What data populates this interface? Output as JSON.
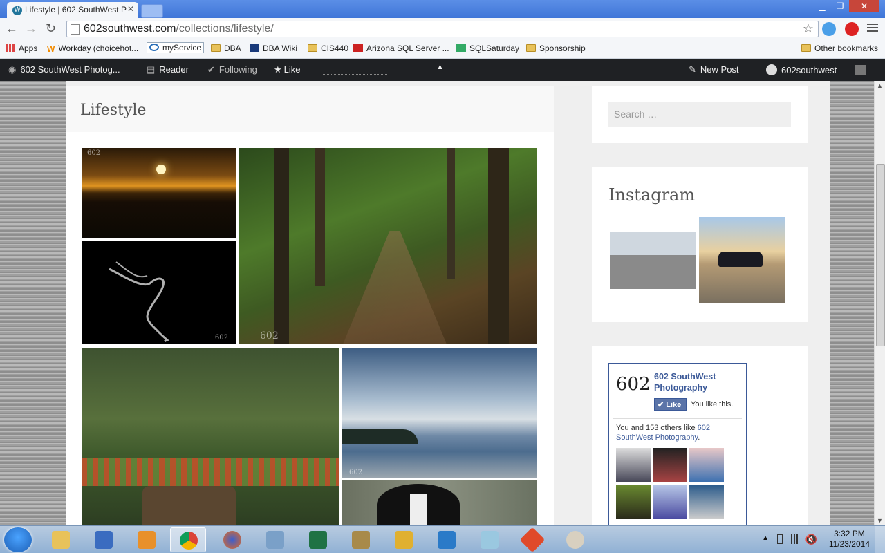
{
  "browser": {
    "tab_title": "Lifestyle | 602 SouthWest P",
    "url_host": "602southwest.com",
    "url_path": "/collections/lifestyle/",
    "bookmarks": [
      "Apps",
      "Workday (choicehot...",
      "myService",
      "DBA",
      "DBA Wiki",
      "CIS440",
      "Arizona SQL Server ...",
      "SQLSaturday",
      "Sponsorship"
    ],
    "other_bookmarks": "Other bookmarks"
  },
  "wpbar": {
    "site": "602 SouthWest Photog...",
    "reader": "Reader",
    "following": "Following",
    "like": "Like",
    "new_post": "New Post",
    "user": "602southwest"
  },
  "main": {
    "title": "Lifestyle",
    "watermark": "602"
  },
  "sidebar": {
    "search_placeholder": "Search …",
    "instagram_title": "Instagram",
    "facebook": {
      "logo": "602",
      "page_name": "602 SouthWest Photography",
      "like_label": "Like",
      "you_like": "You like this.",
      "others_prefix": "You and 153 others like",
      "others_link": "602 SouthWest Photography",
      "others_suffix": "."
    }
  },
  "taskbar": {
    "time": "3:32 PM",
    "date": "11/23/2014"
  }
}
